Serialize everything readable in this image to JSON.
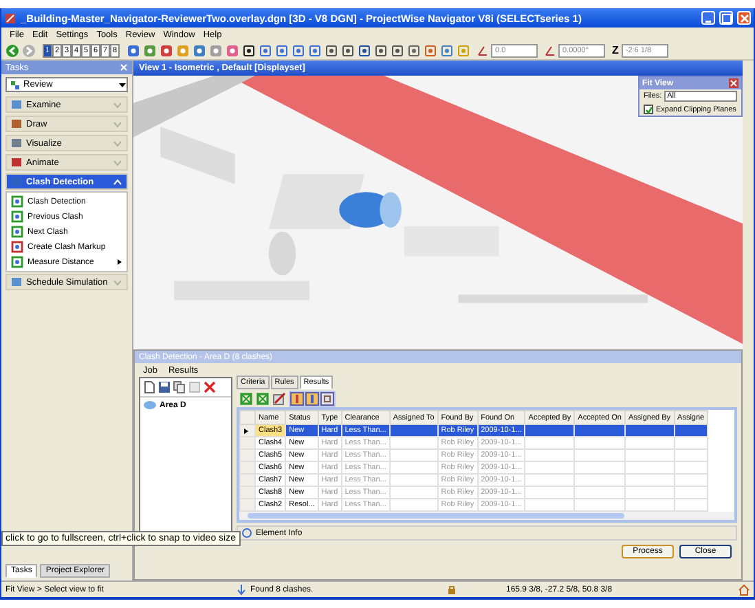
{
  "window": {
    "title": "_Building-Master_Navigator-ReviewerTwo.overlay.dgn [3D - V8 DGN] - ProjectWise Navigator V8i (SELECTseries 1)"
  },
  "menu": [
    "File",
    "Edit",
    "Settings",
    "Tools",
    "Review",
    "Window",
    "Help"
  ],
  "toolbar": {
    "view_buttons": [
      "1",
      "2",
      "3",
      "4",
      "5",
      "6",
      "7",
      "8"
    ],
    "fields": [
      {
        "value": "0.0"
      },
      {
        "value": "0.0000°"
      },
      {
        "label": "Z",
        "value": "-2:6 1/8"
      }
    ]
  },
  "tasks_panel": {
    "title": "Tasks",
    "workflow": "Review",
    "sections": [
      {
        "label": "Examine",
        "expanded": false
      },
      {
        "label": "Draw",
        "expanded": false
      },
      {
        "label": "Visualize",
        "expanded": false
      },
      {
        "label": "Animate",
        "expanded": false
      },
      {
        "label": "Clash Detection",
        "expanded": true,
        "items": [
          {
            "label": "Clash Detection",
            "submenu": false
          },
          {
            "label": "Previous Clash",
            "submenu": false
          },
          {
            "label": "Next Clash",
            "submenu": false
          },
          {
            "label": "Create Clash Markup",
            "submenu": false
          },
          {
            "label": "Measure Distance",
            "submenu": true
          }
        ]
      },
      {
        "label": "Schedule Simulation",
        "expanded": false
      }
    ],
    "tabs": [
      {
        "label": "Tasks",
        "selected": true
      },
      {
        "label": "Project Explorer",
        "selected": false
      }
    ]
  },
  "view": {
    "title": "View 1 - Isometric , Default [Displayset]"
  },
  "fit_view": {
    "title": "Fit View",
    "files_label": "Files:",
    "files_value": "All",
    "option": {
      "label": "Expand Clipping Planes",
      "checked": true
    }
  },
  "clash_dialog": {
    "title": "Clash Detection - Area D (8 clashes)",
    "menu": [
      "Job",
      "Results"
    ],
    "tree": [
      {
        "label": "Area D"
      }
    ],
    "tabs": [
      {
        "label": "Criteria",
        "selected": false
      },
      {
        "label": "Rules",
        "selected": false
      },
      {
        "label": "Results",
        "selected": true
      }
    ],
    "table": {
      "columns": [
        "Name",
        "Status",
        "Type",
        "Clearance",
        "Assigned To",
        "Found By",
        "Found On",
        "Accepted By",
        "Accepted On",
        "Assigned By",
        "Assigne"
      ],
      "rows": [
        {
          "selected": true,
          "cells": [
            "Clash3",
            "New",
            "Hard",
            "Less Than...",
            "",
            "Rob Riley",
            "2009-10-1...",
            "",
            "",
            "",
            ""
          ]
        },
        {
          "selected": false,
          "cells": [
            "Clash4",
            "New",
            "Hard",
            "Less Than...",
            "",
            "Rob Riley",
            "2009-10-1...",
            "",
            "",
            "",
            ""
          ]
        },
        {
          "selected": false,
          "cells": [
            "Clash5",
            "New",
            "Hard",
            "Less Than...",
            "",
            "Rob Riley",
            "2009-10-1...",
            "",
            "",
            "",
            ""
          ]
        },
        {
          "selected": false,
          "cells": [
            "Clash6",
            "New",
            "Hard",
            "Less Than...",
            "",
            "Rob Riley",
            "2009-10-1...",
            "",
            "",
            "",
            ""
          ]
        },
        {
          "selected": false,
          "cells": [
            "Clash7",
            "New",
            "Hard",
            "Less Than...",
            "",
            "Rob Riley",
            "2009-10-1...",
            "",
            "",
            "",
            ""
          ]
        },
        {
          "selected": false,
          "cells": [
            "Clash8",
            "New",
            "Hard",
            "Less Than...",
            "",
            "Rob Riley",
            "2009-10-1...",
            "",
            "",
            "",
            ""
          ]
        },
        {
          "selected": false,
          "cells": [
            "Clash2",
            "Resol...",
            "Hard",
            "Less Than...",
            "",
            "Rob Riley",
            "2009-10-1...",
            "",
            "",
            "",
            ""
          ]
        }
      ]
    },
    "element_info": "Element Info",
    "buttons": [
      {
        "label": "Process",
        "focused": true
      },
      {
        "label": "Close",
        "focused": false
      }
    ]
  },
  "tooltip": "click to go to fullscreen, ctrl+click to snap to video size",
  "status_bar": {
    "prompt": "Fit View > Select view to fit",
    "message": "Found 8 clashes.",
    "coordinates": "165.9 3/8, -27.2 5/8, 50.8 3/8"
  }
}
